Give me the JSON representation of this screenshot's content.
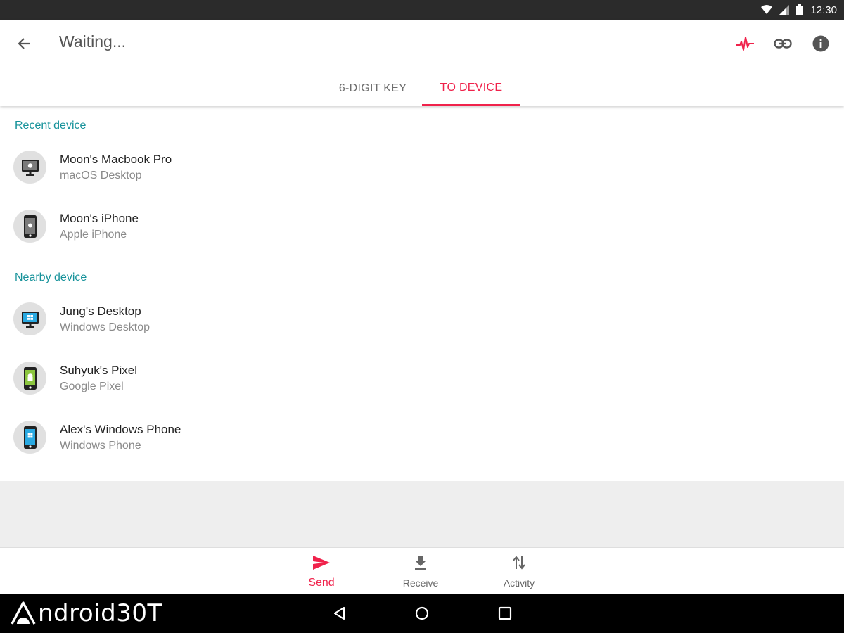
{
  "status_bar": {
    "time": "12:30"
  },
  "header": {
    "title": "Waiting...",
    "actions": [
      {
        "name": "pulse-icon",
        "color": "#f0224b"
      },
      {
        "name": "link-icon"
      },
      {
        "name": "info-icon"
      }
    ]
  },
  "tabs": [
    {
      "label": "6-DIGIT KEY",
      "active": false
    },
    {
      "label": "TO DEVICE",
      "active": true
    }
  ],
  "sections": {
    "recent": {
      "title": "Recent device",
      "devices": [
        {
          "name": "Moon's Macbook Pro",
          "type": "macOS Desktop",
          "icon": "mac-desktop-icon"
        },
        {
          "name": "Moon's iPhone",
          "type": "Apple iPhone",
          "icon": "iphone-icon"
        }
      ]
    },
    "nearby": {
      "title": "Nearby device",
      "devices": [
        {
          "name": "Jung's Desktop",
          "type": "Windows Desktop",
          "icon": "windows-desktop-icon"
        },
        {
          "name": "Suhyuk's Pixel",
          "type": "Google Pixel",
          "icon": "android-phone-icon"
        },
        {
          "name": "Alex's Windows Phone",
          "type": "Windows Phone",
          "icon": "windows-phone-icon"
        }
      ]
    }
  },
  "bottom_nav": [
    {
      "label": "Send",
      "icon": "send-icon",
      "active": true
    },
    {
      "label": "Receive",
      "icon": "download-icon",
      "active": false
    },
    {
      "label": "Activity",
      "icon": "swap-vertical-icon",
      "active": false
    }
  ],
  "watermark": {
    "text": "ndroid30T"
  },
  "colors": {
    "accent": "#f0224b",
    "section": "#16929a",
    "status_bar": "#2b2b2b"
  }
}
